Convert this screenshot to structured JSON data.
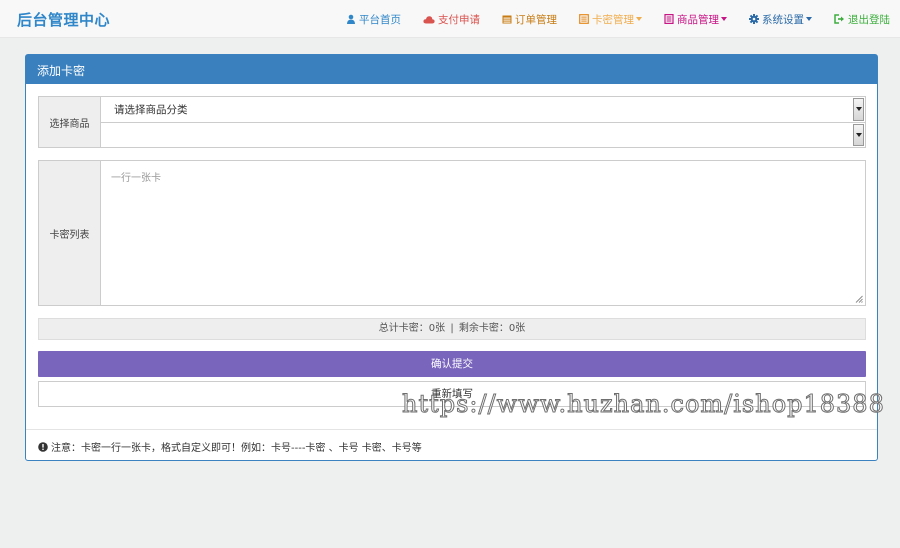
{
  "brand": "后台管理中心",
  "nav": [
    {
      "label": "平台首页",
      "icon": "user-icon",
      "color": "#2f86c9",
      "dropdown": false
    },
    {
      "label": "支付申请",
      "icon": "cloud-icon",
      "color": "#d9534f",
      "dropdown": false
    },
    {
      "label": "订单管理",
      "icon": "calendar-icon",
      "color": "#c77b12",
      "dropdown": false
    },
    {
      "label": "卡密管理",
      "icon": "list-alt-icon",
      "color": "#f0ad4e",
      "dropdown": true
    },
    {
      "label": "商品管理",
      "icon": "book-icon",
      "color": "#c71585",
      "dropdown": true
    },
    {
      "label": "系统设置",
      "icon": "gear-icon",
      "color": "#2a6aa8",
      "dropdown": true
    },
    {
      "label": "退出登陆",
      "icon": "logout-icon",
      "color": "#3cae3c",
      "dropdown": false
    }
  ],
  "panel": {
    "title": "添加卡密",
    "select_label": "选择商品",
    "category_value": "请选择商品分类",
    "product_value": "",
    "list_label": "卡密列表",
    "textarea_placeholder": "一行一张卡",
    "count_total": "总计卡密：0张",
    "count_sep": "|",
    "count_remaining": "剩余卡密：0张",
    "submit_label": "确认提交",
    "reset_label": "重新填写",
    "note": "注意：卡密一行一张卡，格式自定义即可！例如：卡号----卡密 、卡号 卡密、卡号等"
  },
  "watermark": "https://www.huzhan.com/ishop18388",
  "colors": {
    "brand": "#2f86c9",
    "panel_heading": "#3a80bf",
    "submit": "#7a65bd"
  }
}
